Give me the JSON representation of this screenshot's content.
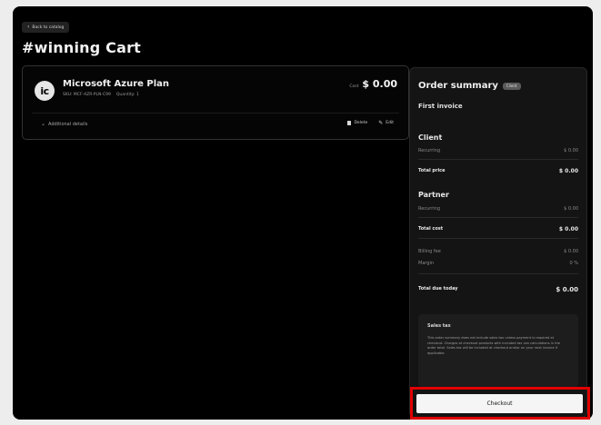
{
  "nav": {
    "back_label": "Back to catalog"
  },
  "page": {
    "title": "#winning Cart"
  },
  "cart_item": {
    "logo_text": "ic",
    "name": "Microsoft Azure Plan",
    "sku": "SKU: MCF-AZR-PLN-C99",
    "quantity": "Quantity: 1",
    "cost_label": "Cost",
    "cost_value": "$ 0.00",
    "details_label": "Additional details",
    "delete_label": "Delete",
    "edit_label": "Edit"
  },
  "summary": {
    "title": "Order summary",
    "badge": "Client",
    "first_invoice": "First invoice",
    "client": {
      "heading": "Client",
      "recurring_label": "Recurring",
      "recurring_value": "$ 0.00",
      "total_label": "Total price",
      "total_value": "$ 0.00"
    },
    "partner": {
      "heading": "Partner",
      "recurring_label": "Recurring",
      "recurring_value": "$ 0.00",
      "total_label": "Total cost",
      "total_value": "$ 0.00"
    },
    "billing_fee_label": "Billing fee",
    "billing_fee_value": "$ 0.00",
    "margin_label": "Margin",
    "margin_value": "0 %",
    "due_label": "Total due today",
    "due_value": "$ 0.00",
    "tax": {
      "title": "Sales tax",
      "text": "This order summary does not include sales tax unless payment is required at checkout. Charges at checkout products with included tax can calculations in the order total. Sales tax will be included at checkout and/or on your next invoice if applicable."
    },
    "checkout_label": "Checkout"
  },
  "colors": {
    "highlight": "#e10000",
    "background": "#000000",
    "panel": "#141414"
  }
}
